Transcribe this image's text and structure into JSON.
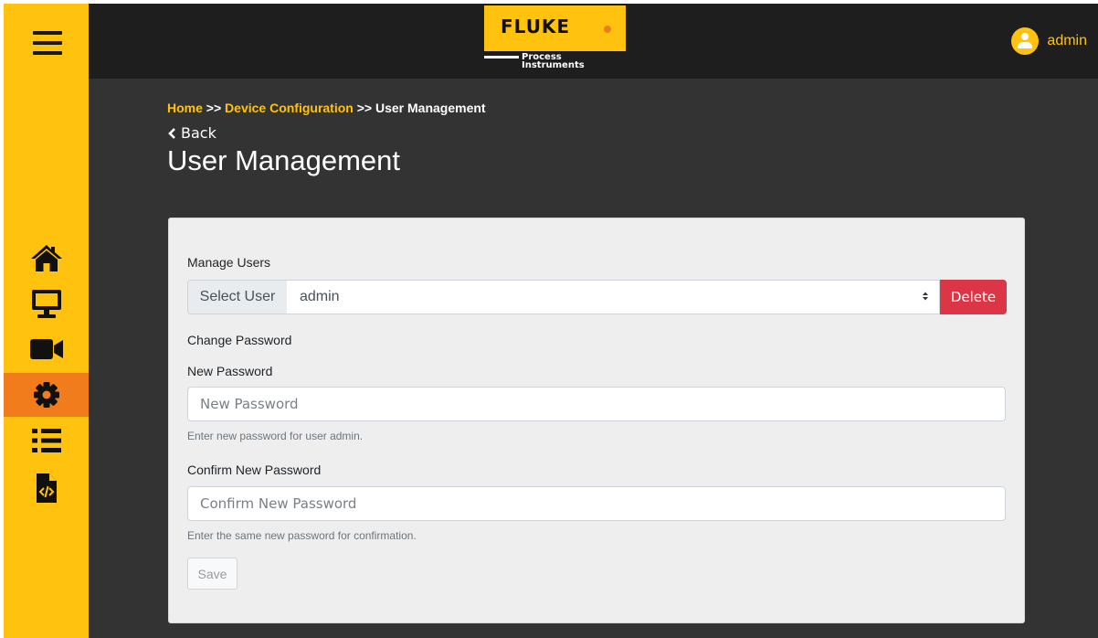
{
  "sidebar": {
    "items": [
      {
        "id": "home",
        "icon": "home-icon",
        "active": false
      },
      {
        "id": "monitor",
        "icon": "monitor-icon",
        "active": false
      },
      {
        "id": "video",
        "icon": "video-camera-icon",
        "active": false
      },
      {
        "id": "settings",
        "icon": "gear-icon",
        "active": true
      },
      {
        "id": "list",
        "icon": "list-icon",
        "active": false
      },
      {
        "id": "code-file",
        "icon": "code-file-icon",
        "active": false
      }
    ],
    "accent_color": "#ffc20e",
    "active_color": "#f07c1b"
  },
  "header": {
    "logo_text": "FLUKE",
    "logo_sub_line1": "Process",
    "logo_sub_line2": "Instruments",
    "username": "admin"
  },
  "breadcrumb": {
    "home": "Home",
    "sep1": ">>",
    "device_config": "Device Configuration",
    "sep2": ">>",
    "current": "User Management"
  },
  "back_label": "Back",
  "page_title": "User Management",
  "form": {
    "manage_users_label": "Manage Users",
    "select_prepend": "Select User",
    "selected_user": "admin",
    "delete_label": "Delete",
    "change_password_label": "Change Password",
    "new_password_label": "New Password",
    "new_password_placeholder": "New Password",
    "new_password_help": "Enter new password for user admin.",
    "confirm_label": "Confirm New Password",
    "confirm_placeholder": "Confirm New Password",
    "confirm_help": "Enter the same new password for confirmation.",
    "save_label": "Save"
  }
}
